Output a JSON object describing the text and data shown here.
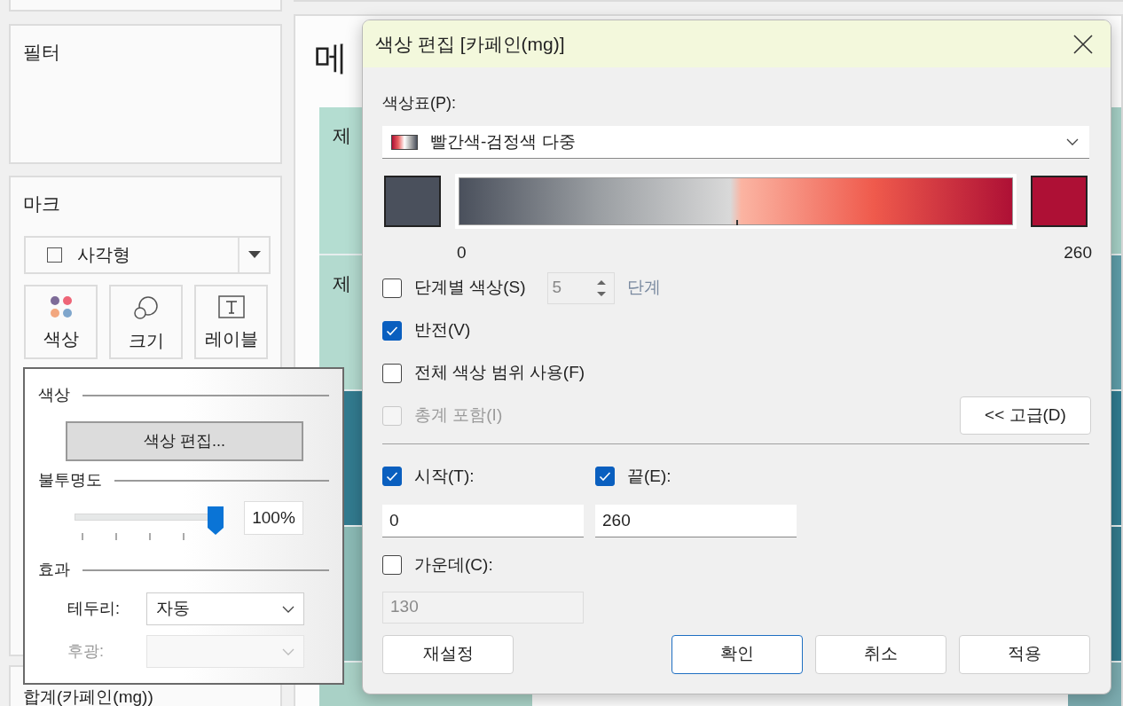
{
  "left_panel": {
    "filter": {
      "title": "필터"
    },
    "marks": {
      "title": "마크",
      "mark_type": "사각형",
      "buttons": [
        {
          "kind": "color",
          "label": "색상"
        },
        {
          "kind": "size",
          "label": "크기"
        },
        {
          "kind": "label",
          "label": "레이블"
        }
      ]
    },
    "sum_field": "합계(카페인(mg))"
  },
  "view": {
    "title": "메",
    "rows": [
      {
        "label": "제",
        "color": "#b4ddd1"
      },
      {
        "label": "제",
        "color": "#b3dacf"
      },
      {
        "color": "#327b8f"
      },
      {
        "color": "#8bbab5"
      },
      {
        "color": "#a9d1c6"
      }
    ],
    "edge_cells": [
      {
        "color": "#a6d0c6"
      },
      {
        "color": "#5f9ea9"
      },
      {
        "color": "#317c90"
      },
      {
        "color": "#347b8d"
      },
      {
        "color": "#7cacb0"
      }
    ]
  },
  "color_popup": {
    "color_header": "색상",
    "edit_button": "색상 편집...",
    "opacity_header": "불투명도",
    "opacity": {
      "level": 1,
      "reading": "100%"
    },
    "effects_header": "효과",
    "border": {
      "label": "테두리:",
      "value": "자동"
    },
    "halo": {
      "label": "후광:",
      "disabled": true
    }
  },
  "dialog": {
    "title": "색상 편집 [카페인(mg)]",
    "palette_label": "색상표(P):",
    "palette": "빨간색-검정색 다중",
    "range_min": "0",
    "range_max": "260",
    "options": [
      {
        "kind": "stepped",
        "label": "단계별 색상(S)",
        "checked": false,
        "disabled": false,
        "steps": "5",
        "unit": "단계"
      },
      {
        "kind": "plain",
        "label": "반전(V)",
        "checked": true,
        "disabled": false
      },
      {
        "kind": "plain",
        "label": "전체 색상 범위 사용(F)",
        "checked": false,
        "disabled": false
      },
      {
        "kind": "plain",
        "label": "총계 포함(I)",
        "checked": false,
        "disabled": true
      }
    ],
    "advanced_button": "<< 고급(D)",
    "start": {
      "label": "시작(T):",
      "checked": true,
      "value": "0"
    },
    "end": {
      "label": "끝(E):",
      "checked": true,
      "value": "260"
    },
    "center": {
      "label": "가운데(C):",
      "checked": false,
      "value": "130"
    },
    "buttons": [
      {
        "label": "재설정",
        "default": false
      },
      {
        "label": "확인",
        "default": true
      },
      {
        "label": "취소",
        "default": false
      },
      {
        "label": "적용",
        "default": false
      }
    ]
  }
}
